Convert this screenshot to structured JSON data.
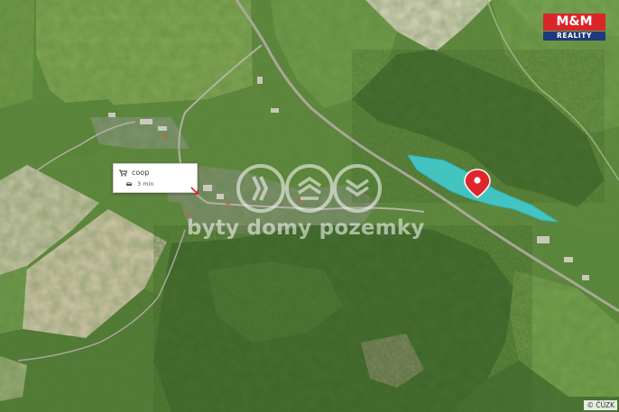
{
  "poi": {
    "name": "coop",
    "travel_time": "3 min",
    "icon": "shopping-cart-icon",
    "travel_icon": "car-icon"
  },
  "watermark": {
    "text": "byty domy pozemky"
  },
  "logo": {
    "line1": "M&M",
    "line2": "REALITY",
    "color_primary": "#d9262a",
    "color_secondary": "#1f3a7a"
  },
  "attribution": "© ČÚZK",
  "marker": {
    "icon": "location-pin-icon",
    "color": "#e0252b"
  },
  "parcel": {
    "color": "#3fd0d8"
  }
}
